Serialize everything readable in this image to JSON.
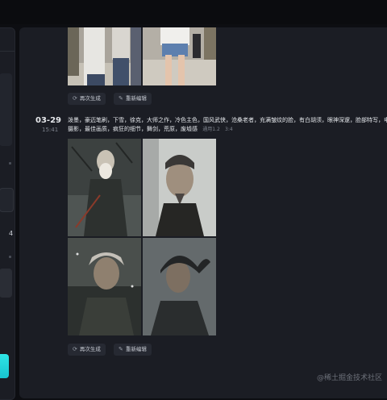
{
  "sidebar": {
    "count_label": "4"
  },
  "entry_previous": {
    "regenerate_label": "再次生成",
    "reedit_label": "重新编辑"
  },
  "entry": {
    "date": "03-29",
    "time": "15:41",
    "prompt": "泼墨，豪迈笔刷，下雪，徐克，大师之作，冷色主色，国风武侠，沧桑老者，充满皱纹的脸，有白胡须，眼神深邃，脸部特写，电影",
    "prompt_line2": "摄影，最佳画质，疯狂的细节，舞剑，荒原，废墟感",
    "model": "通用1.2",
    "ratio": "3:4",
    "regenerate_label": "再次生成",
    "reedit_label": "重新编辑"
  },
  "watermark": "@稀土掘金技术社区",
  "icons": {
    "regenerate": "refresh-icon",
    "reedit": "edit-icon"
  }
}
